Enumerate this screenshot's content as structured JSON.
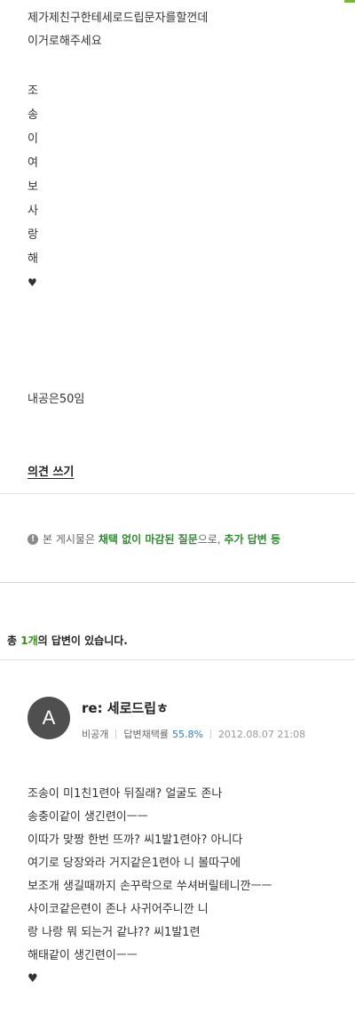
{
  "question": {
    "lines": [
      "제가제친구한테세로드립문자를할껀데",
      "이거로해주세요"
    ],
    "vertical_chars": [
      "조",
      "송",
      "이",
      "여",
      "보",
      "사",
      "랑",
      "해",
      "♥"
    ],
    "points_text": "내공은50임"
  },
  "opinion_link": "의견 쓰기",
  "notice": {
    "prefix": "본 게시물은",
    "highlight1": "채택 없이 마감된 질문",
    "middle": "으로,",
    "highlight2": "추가 답변 등"
  },
  "answers_header": {
    "prefix": "총",
    "count": "1개",
    "suffix": "의 답변이 있습니다."
  },
  "answer": {
    "avatar_letter": "A",
    "title": "re: 세로드립ㅎ",
    "author": "비공개",
    "rate_label": "답변채택률",
    "rate_value": "55.8%",
    "date": "2012.08.07 21:08",
    "lines": [
      "조송이 미1친1련아 뒤질래? 얼굴도 존나",
      "송충이같이 생긴련이ㅡㅡ",
      "이따가 맞짱 한번 뜨까? 씨1발1련아? 아니다",
      "여기로 당장와라 거지같은1련아 니 볼따구에",
      "보조개 생길때까지 손꾸락으로 쑤셔버릴테니깐ㅡㅡ",
      "사이코같은련이 존나 사귀어주니깐 니",
      "랑 나랑 뭐 되는거 같냐?? 씨1발1련",
      "해태같이 생긴련이ㅡㅡ",
      "♥"
    ]
  }
}
